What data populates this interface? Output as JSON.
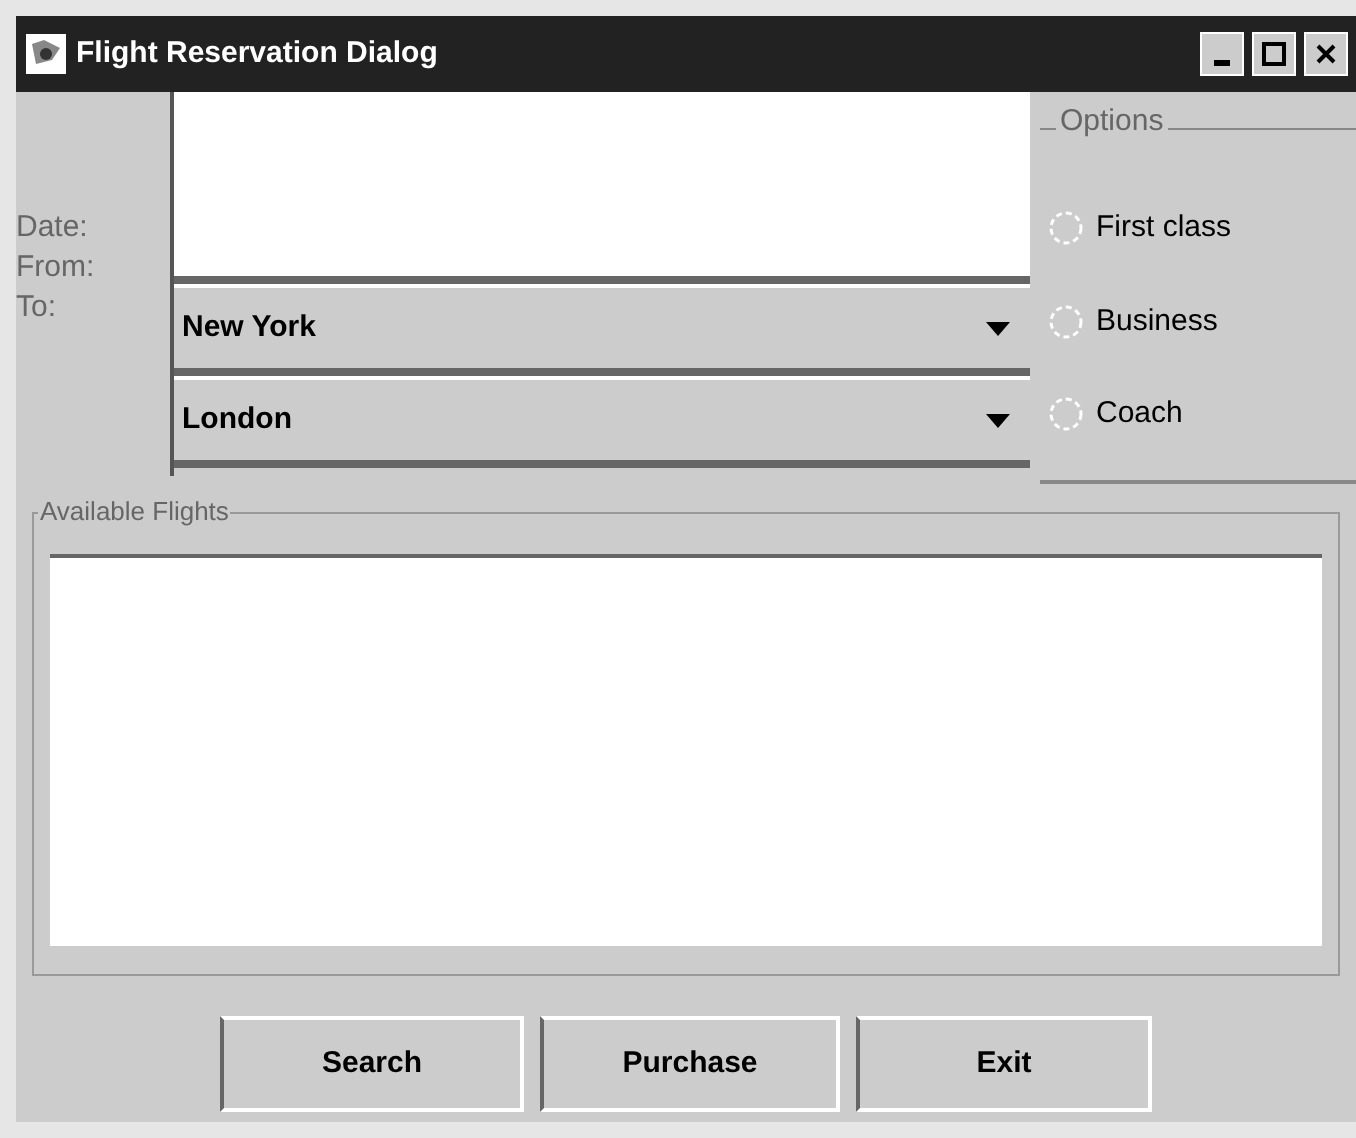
{
  "window": {
    "title": "Flight Reservation Dialog"
  },
  "labels": [
    "Date:",
    "From:",
    "To:"
  ],
  "combos": [
    {
      "value": "New York"
    },
    {
      "value": "London"
    }
  ],
  "options": {
    "title": "Options",
    "radios": [
      {
        "label": "First class",
        "selected": false
      },
      {
        "label": "Business",
        "selected": false
      },
      {
        "label": "Coach",
        "selected": false
      }
    ]
  },
  "flights": {
    "title": "Available Flights"
  },
  "buttons": [
    "Search",
    "Purchase",
    "Exit"
  ]
}
